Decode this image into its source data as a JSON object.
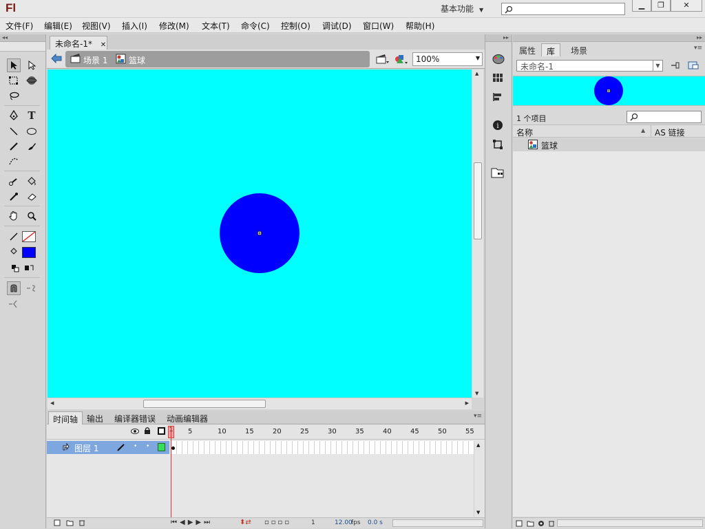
{
  "app": {
    "logo": "Fl",
    "workspace": "基本功能",
    "search_placeholder": ""
  },
  "window_controls": [
    "minimize",
    "restore",
    "close"
  ],
  "menu": [
    "文件(F)",
    "编辑(E)",
    "视图(V)",
    "插入(I)",
    "修改(M)",
    "文本(T)",
    "命令(C)",
    "控制(O)",
    "调试(D)",
    "窗口(W)",
    "帮助(H)"
  ],
  "document": {
    "tab_title": "未命名-1*",
    "breadcrumb_scene": "场景 1",
    "breadcrumb_symbol": "篮球",
    "zoom": "100%"
  },
  "colors": {
    "stage": "#00ffff",
    "ball": "#0000ff",
    "fill_swatch": "#0000ff",
    "layer_highlight": "#7fa7df",
    "playhead": "#e03131"
  },
  "timeline": {
    "tabs": [
      "时间轴",
      "输出",
      "编译器错误",
      "动画编辑器"
    ],
    "active_tab": "时间轴",
    "frame_numbers": [
      "1",
      "5",
      "10",
      "15",
      "20",
      "25",
      "30",
      "35",
      "40",
      "45",
      "50",
      "55"
    ],
    "layer_name": "图层 1",
    "current_frame": "1",
    "fps": "12.00",
    "fps_unit": "fps",
    "elapsed": "0.0 s"
  },
  "library": {
    "tabs": [
      "属性",
      "库",
      "场景"
    ],
    "active_tab": "库",
    "document_select": "未命名-1",
    "item_count": "1 个项目",
    "col_name": "名称",
    "col_linkage": "AS 链接",
    "items": [
      {
        "name": "篮球"
      }
    ]
  }
}
